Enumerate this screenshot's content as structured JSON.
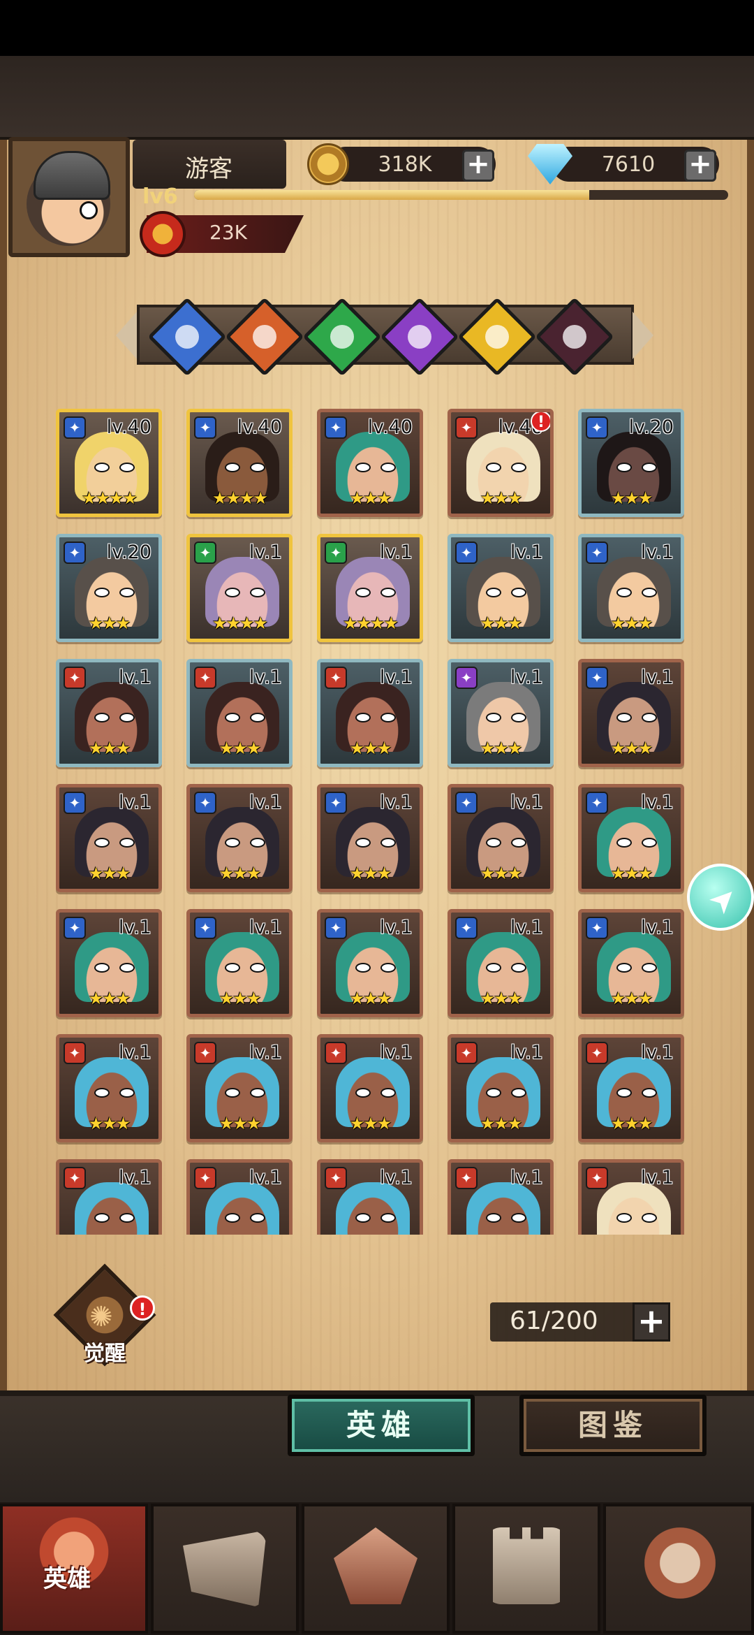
{
  "player": {
    "name": "游客",
    "level": "lv6",
    "xp_fraction": 0.74,
    "power": "23K"
  },
  "resources": {
    "gold": "318K",
    "diamonds": "7610"
  },
  "elements": [
    {
      "name": "ice-element-icon",
      "color": "#3c6fd0"
    },
    {
      "name": "fire-element-icon",
      "color": "#d6602a"
    },
    {
      "name": "nature-element-icon",
      "color": "#2ea84a"
    },
    {
      "name": "arcane-element-icon",
      "color": "#8a3fc4"
    },
    {
      "name": "light-element-icon",
      "color": "#e9b824"
    },
    {
      "name": "dark-element-icon",
      "color": "#4a2330"
    }
  ],
  "heroes": [
    {
      "level": "lv.40",
      "stars": "★★★★",
      "frame": "gold",
      "cls": "blue",
      "alert": false,
      "skin": "#f2cf9a",
      "hair": "#f0d36a"
    },
    {
      "level": "lv.40",
      "stars": "★★★★",
      "frame": "gold",
      "cls": "blue",
      "alert": false,
      "skin": "#8a5a3c",
      "hair": "#2a1d18"
    },
    {
      "level": "lv.40",
      "stars": "★★★",
      "frame": "bronze",
      "cls": "blue",
      "alert": false,
      "skin": "#e7b796",
      "hair": "#2f9a86"
    },
    {
      "level": "lv.40",
      "stars": "★★★",
      "frame": "bronze",
      "cls": "red",
      "alert": true,
      "skin": "#f2d4ae",
      "hair": "#efe1be"
    },
    {
      "level": "lv.20",
      "stars": "★★★",
      "frame": "teal",
      "cls": "blue",
      "alert": false,
      "skin": "#6a4a44",
      "hair": "#1e1717"
    },
    {
      "level": "lv.20",
      "stars": "★★★",
      "frame": "teal",
      "cls": "blue",
      "alert": false,
      "skin": "#f3caa0",
      "hair": "#58504a"
    },
    {
      "level": "lv.1",
      "stars": "★★★★",
      "frame": "gold",
      "cls": "green",
      "alert": false,
      "skin": "#e7b7b8",
      "hair": "#9a86b6"
    },
    {
      "level": "lv.1",
      "stars": "★★★★",
      "frame": "gold",
      "cls": "green",
      "alert": false,
      "skin": "#e7b7b8",
      "hair": "#9a86b6"
    },
    {
      "level": "lv.1",
      "stars": "★★★",
      "frame": "teal",
      "cls": "blue",
      "alert": false,
      "skin": "#f3caa0",
      "hair": "#58504a"
    },
    {
      "level": "lv.1",
      "stars": "★★★",
      "frame": "teal",
      "cls": "blue",
      "alert": false,
      "skin": "#f3caa0",
      "hair": "#58504a"
    },
    {
      "level": "lv.1",
      "stars": "★★★",
      "frame": "teal",
      "cls": "red",
      "alert": false,
      "skin": "#b2705a",
      "hair": "#3a2320"
    },
    {
      "level": "lv.1",
      "stars": "★★★",
      "frame": "teal",
      "cls": "red",
      "alert": false,
      "skin": "#b2705a",
      "hair": "#3a2320"
    },
    {
      "level": "lv.1",
      "stars": "★★★",
      "frame": "teal",
      "cls": "red",
      "alert": false,
      "skin": "#b2705a",
      "hair": "#3a2320"
    },
    {
      "level": "lv.1",
      "stars": "★★★",
      "frame": "teal",
      "cls": "purple",
      "alert": false,
      "skin": "#efc8a8",
      "hair": "#7b7b7b"
    },
    {
      "level": "lv.1",
      "stars": "★★★",
      "frame": "bronze",
      "cls": "blue",
      "alert": false,
      "skin": "#c99a80",
      "hair": "#2b2630"
    },
    {
      "level": "lv.1",
      "stars": "★★★",
      "frame": "bronze",
      "cls": "blue",
      "alert": false,
      "skin": "#c99a80",
      "hair": "#2b2630"
    },
    {
      "level": "lv.1",
      "stars": "★★★",
      "frame": "bronze",
      "cls": "blue",
      "alert": false,
      "skin": "#c99a80",
      "hair": "#2b2630"
    },
    {
      "level": "lv.1",
      "stars": "★★★",
      "frame": "bronze",
      "cls": "blue",
      "alert": false,
      "skin": "#c99a80",
      "hair": "#2b2630"
    },
    {
      "level": "lv.1",
      "stars": "★★★",
      "frame": "bronze",
      "cls": "blue",
      "alert": false,
      "skin": "#c99a80",
      "hair": "#2b2630"
    },
    {
      "level": "lv.1",
      "stars": "★★★",
      "frame": "bronze",
      "cls": "blue",
      "alert": false,
      "skin": "#e7b796",
      "hair": "#2f9a86"
    },
    {
      "level": "lv.1",
      "stars": "★★★",
      "frame": "bronze",
      "cls": "blue",
      "alert": false,
      "skin": "#e7b796",
      "hair": "#2f9a86"
    },
    {
      "level": "lv.1",
      "stars": "★★★",
      "frame": "bronze",
      "cls": "blue",
      "alert": false,
      "skin": "#e7b796",
      "hair": "#2f9a86"
    },
    {
      "level": "lv.1",
      "stars": "★★★",
      "frame": "bronze",
      "cls": "blue",
      "alert": false,
      "skin": "#e7b796",
      "hair": "#2f9a86"
    },
    {
      "level": "lv.1",
      "stars": "★★★",
      "frame": "bronze",
      "cls": "blue",
      "alert": false,
      "skin": "#e7b796",
      "hair": "#2f9a86"
    },
    {
      "level": "lv.1",
      "stars": "★★★",
      "frame": "bronze",
      "cls": "blue",
      "alert": false,
      "skin": "#e7b796",
      "hair": "#2f9a86"
    },
    {
      "level": "lv.1",
      "stars": "★★★",
      "frame": "bronze",
      "cls": "red",
      "alert": false,
      "skin": "#9a6048",
      "hair": "#4fb6d6"
    },
    {
      "level": "lv.1",
      "stars": "★★★",
      "frame": "bronze",
      "cls": "red",
      "alert": false,
      "skin": "#9a6048",
      "hair": "#4fb6d6"
    },
    {
      "level": "lv.1",
      "stars": "★★★",
      "frame": "bronze",
      "cls": "red",
      "alert": false,
      "skin": "#9a6048",
      "hair": "#4fb6d6"
    },
    {
      "level": "lv.1",
      "stars": "★★★",
      "frame": "bronze",
      "cls": "red",
      "alert": false,
      "skin": "#9a6048",
      "hair": "#4fb6d6"
    },
    {
      "level": "lv.1",
      "stars": "★★★",
      "frame": "bronze",
      "cls": "red",
      "alert": false,
      "skin": "#9a6048",
      "hair": "#4fb6d6"
    },
    {
      "level": "lv.1",
      "stars": "",
      "frame": "bronze",
      "cls": "red",
      "alert": false,
      "skin": "#9a6048",
      "hair": "#4fb6d6"
    },
    {
      "level": "lv.1",
      "stars": "",
      "frame": "bronze",
      "cls": "red",
      "alert": false,
      "skin": "#9a6048",
      "hair": "#4fb6d6"
    },
    {
      "level": "lv.1",
      "stars": "",
      "frame": "bronze",
      "cls": "red",
      "alert": false,
      "skin": "#9a6048",
      "hair": "#4fb6d6"
    },
    {
      "level": "lv.1",
      "stars": "",
      "frame": "bronze",
      "cls": "red",
      "alert": false,
      "skin": "#9a6048",
      "hair": "#4fb6d6"
    },
    {
      "level": "lv.1",
      "stars": "",
      "frame": "bronze",
      "cls": "red",
      "alert": false,
      "skin": "#f2d4ae",
      "hair": "#efe1be"
    }
  ],
  "awaken": {
    "label": "觉醒",
    "badge": "!"
  },
  "capacity": "61/200",
  "tabs": {
    "heroes": "英雄",
    "codex": "图鉴"
  },
  "nav": {
    "heroes_label": "英雄"
  },
  "alert_mark": "!",
  "plus": "+",
  "colors": {
    "class_blue": "#2f63c8",
    "class_red": "#c83a2a",
    "class_green": "#2aa14a",
    "class_purple": "#8a3fc4"
  }
}
